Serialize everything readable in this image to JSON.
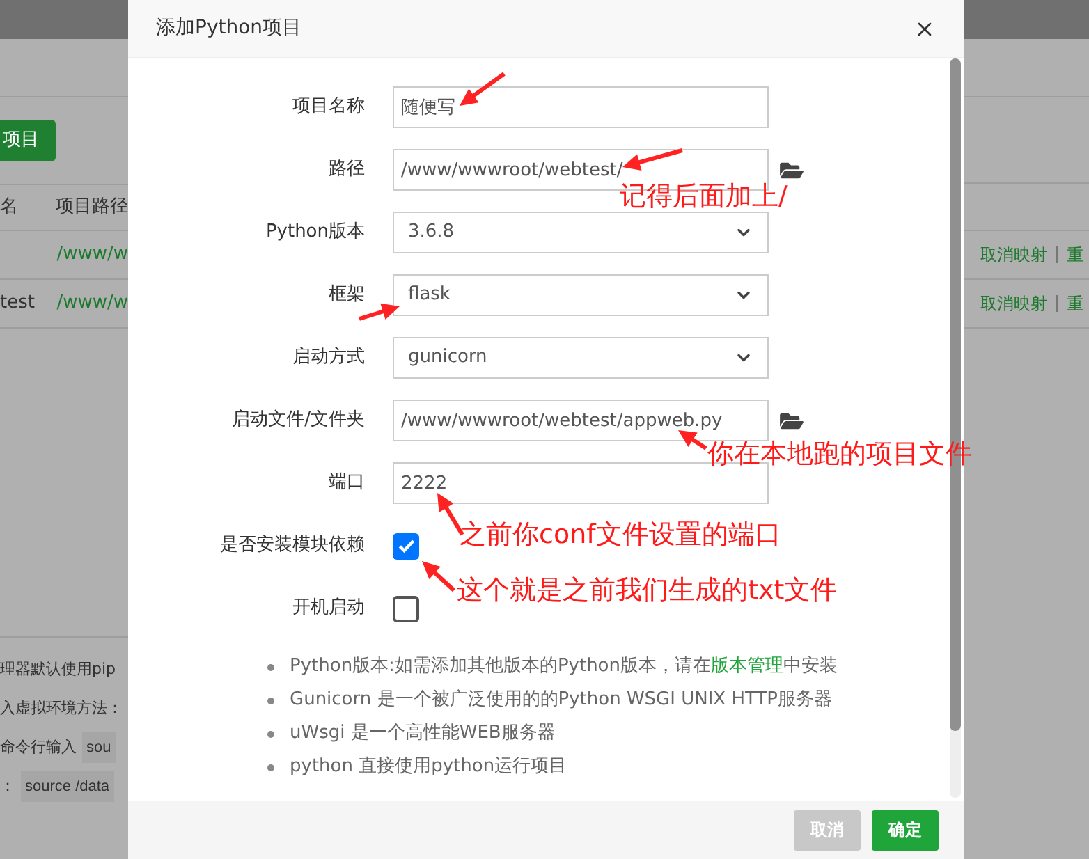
{
  "background": {
    "add_button": "项目",
    "table": {
      "columns": [
        "名",
        "项目路径"
      ],
      "rows": [
        {
          "name": "",
          "path": "/www/w",
          "actions": [
            "取消映射",
            "重"
          ]
        },
        {
          "name": "test",
          "path": "/www/w",
          "actions": [
            "取消映射",
            "重"
          ]
        }
      ]
    },
    "notes": [
      {
        "text": "理器默认使用pip"
      },
      {
        "text": "入虚拟环境方法："
      },
      {
        "text": "命令行输入",
        "code": "sou"
      },
      {
        "text": "：",
        "code": "source /data"
      }
    ]
  },
  "dialog": {
    "title": "添加Python项目",
    "fields": [
      {
        "kind": "text",
        "label": "项目名称",
        "value": "随便写",
        "browse": false
      },
      {
        "kind": "text",
        "label": "路径",
        "value": "/www/wwwroot/webtest/",
        "browse": true
      },
      {
        "kind": "select",
        "label": "Python版本",
        "value": "3.6.8"
      },
      {
        "kind": "select",
        "label": "框架",
        "value": "flask"
      },
      {
        "kind": "select",
        "label": "启动方式",
        "value": "gunicorn"
      },
      {
        "kind": "text",
        "label": "启动文件/文件夹",
        "value": "/www/wwwroot/webtest/appweb.py",
        "browse": true
      },
      {
        "kind": "text",
        "label": "端口",
        "value": "2222",
        "browse": false
      },
      {
        "kind": "checkbox",
        "label": "是否安装模块依赖",
        "checked": true
      },
      {
        "kind": "checkbox",
        "label": "开机启动",
        "checked": false
      }
    ],
    "notes": [
      {
        "text": "Python版本:如需添加其他版本的Python版本，请在",
        "link": "版本管理",
        "after": "中安装"
      },
      {
        "text": "Gunicorn 是一个被广泛使用的的Python WSGI UNIX HTTP服务器"
      },
      {
        "text": "uWsgi 是一个高性能WEB服务器"
      },
      {
        "text": "python 直接使用python运行项目"
      }
    ],
    "buttons": [
      {
        "label": "取消",
        "kind": "cancel"
      },
      {
        "label": "确定",
        "kind": "primary"
      }
    ]
  },
  "annotations": [
    "记得后面加上/",
    "你在本地跑的项目文件",
    "之前你conf文件设置的端口",
    "这个就是之前我们生成的txt文件"
  ]
}
